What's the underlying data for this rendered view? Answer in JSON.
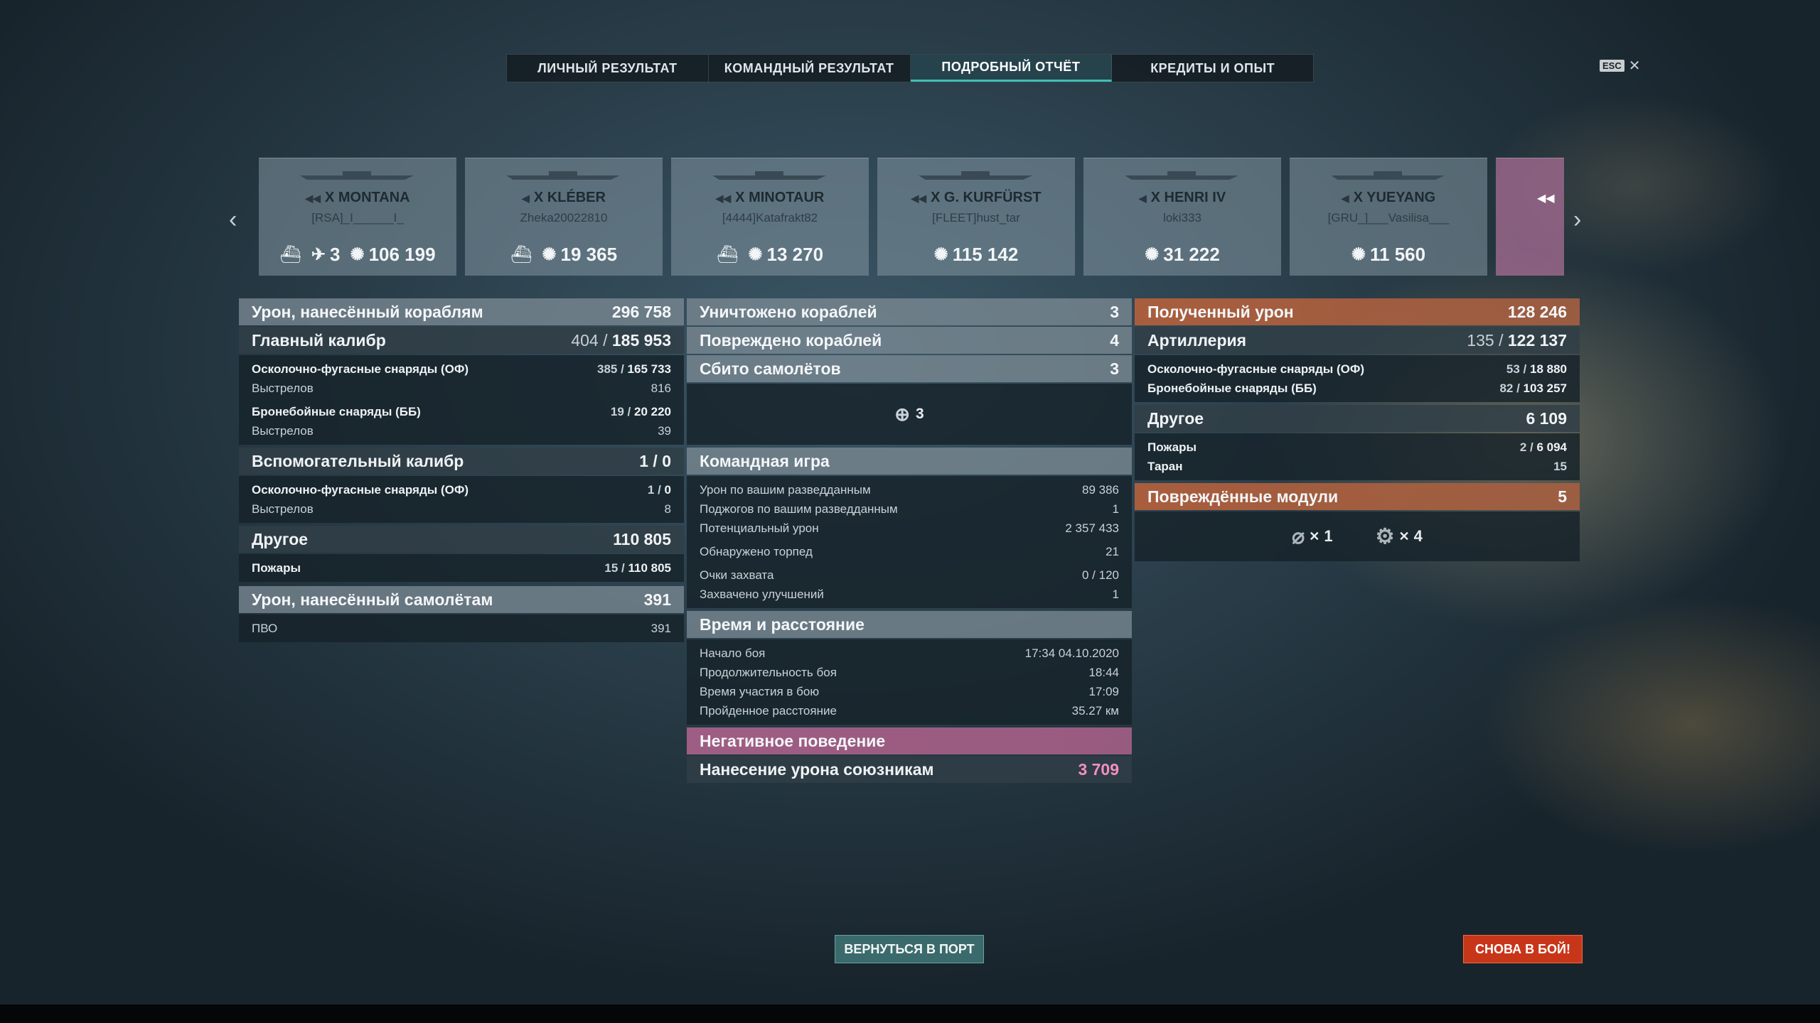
{
  "tabs": [
    "ЛИЧНЫЙ РЕЗУЛЬТАТ",
    "КОМАНДНЫЙ РЕЗУЛЬТАТ",
    "ПОДРОБНЫЙ ОТЧЁТ",
    "КРЕДИТЫ И ОПЫТ"
  ],
  "active_tab": "ПОДРОБНЫЙ ОТЧЁТ",
  "esc_label": "ESC",
  "ships": [
    {
      "tier": "X",
      "name": "MONTANA",
      "player": "[RSA]_I______I_",
      "planes": "3",
      "damage": "106 199"
    },
    {
      "tier": "X",
      "name": "KLÉBER",
      "player": "Zheka20022810",
      "damage": "19 365"
    },
    {
      "tier": "X",
      "name": "MINOTAUR",
      "player": "[4444]Katafrakt82",
      "damage": "13 270"
    },
    {
      "tier": "X",
      "name": "G. KURFÜRST",
      "player": "[FLEET]hust_tar",
      "damage": "115 142"
    },
    {
      "tier": "X",
      "name": "HENRI IV",
      "player": "loki333",
      "damage": "31 222"
    },
    {
      "tier": "X",
      "name": "YUEYANG",
      "player": "[GRU_]___Vasilisa___",
      "damage": "11 560"
    }
  ],
  "left": {
    "ship_damage": {
      "label": "Урон, нанесённый кораблям",
      "value": "296 758"
    },
    "main": {
      "label": "Главный калибр",
      "hits": "404",
      "damage": "185 953"
    },
    "main_rows": [
      {
        "label": "Осколочно-фугасные снаряды (ОФ)",
        "hits": "385",
        "damage": "165 733"
      },
      {
        "label": "Выстрелов",
        "value": "816"
      },
      {
        "label": "Бронебойные снаряды (ББ)",
        "hits": "19",
        "damage": "20 220"
      },
      {
        "label": "Выстрелов",
        "value": "39"
      }
    ],
    "secondary": {
      "label": "Вспомогательный калибр",
      "hits": "1",
      "damage": "0"
    },
    "secondary_rows": [
      {
        "label": "Осколочно-фугасные снаряды (ОФ)",
        "hits": "1",
        "damage": "0"
      },
      {
        "label": "Выстрелов",
        "value": "8"
      }
    ],
    "other": {
      "label": "Другое",
      "value": "110 805"
    },
    "other_rows": [
      {
        "label": "Пожары",
        "hits": "15",
        "damage": "110 805"
      }
    ],
    "plane_damage": {
      "label": "Урон, нанесённый самолётам",
      "value": "391"
    },
    "plane_rows": [
      {
        "label": "ПВО",
        "value": "391"
      }
    ]
  },
  "center": {
    "destroyed": {
      "label": "Уничтожено кораблей",
      "value": "3"
    },
    "damaged": {
      "label": "Повреждено кораблей",
      "value": "4"
    },
    "planes_shot": {
      "label": "Сбито самолётов",
      "value": "3"
    },
    "planes_icon_value": "3",
    "team": {
      "label": "Командная игра"
    },
    "team_rows": [
      {
        "label": "Урон по вашим разведданным",
        "value": "89 386"
      },
      {
        "label": "Поджогов по вашим разведданным",
        "value": "1"
      },
      {
        "label": "Потенциальный урон",
        "value": "2 357 433"
      },
      {
        "label": "Обнаружено торпед",
        "value": "21"
      },
      {
        "label": "Очки захвата",
        "value": "0 / 120"
      },
      {
        "label": "Захвачено улучшений",
        "value": "1"
      }
    ],
    "time": {
      "label": "Время и расстояние"
    },
    "time_rows": [
      {
        "label": "Начало боя",
        "value": "17:34  04.10.2020"
      },
      {
        "label": "Продолжительность боя",
        "value": "18:44"
      },
      {
        "label": "Время участия в бою",
        "value": "17:09"
      },
      {
        "label": "Пройденное расстояние",
        "value": "35.27 км"
      }
    ],
    "negative": {
      "label": "Негативное поведение"
    },
    "negative_row": {
      "label": "Нанесение урона союзникам",
      "value": "3 709"
    }
  },
  "right": {
    "received": {
      "label": "Полученный урон",
      "value": "128 246"
    },
    "artillery": {
      "label": "Артиллерия",
      "hits": "135",
      "damage": "122 137"
    },
    "artillery_rows": [
      {
        "label": "Осколочно-фугасные снаряды (ОФ)",
        "hits": "53",
        "damage": "18 880"
      },
      {
        "label": "Бронебойные снаряды (ББ)",
        "hits": "82",
        "damage": "103 257"
      }
    ],
    "other": {
      "label": "Другое",
      "value": "6 109"
    },
    "other_rows": [
      {
        "label": "Пожары",
        "hits": "2",
        "damage": "6 094"
      },
      {
        "label": "Таран",
        "value": "15"
      }
    ],
    "modules": {
      "label": "Повреждённые модули",
      "value": "5"
    },
    "module_counts": [
      "1",
      "4"
    ]
  },
  "buttons": {
    "port": "ВЕРНУТЬСЯ В ПОРТ",
    "battle": "СНОВА В БОЙ!"
  }
}
